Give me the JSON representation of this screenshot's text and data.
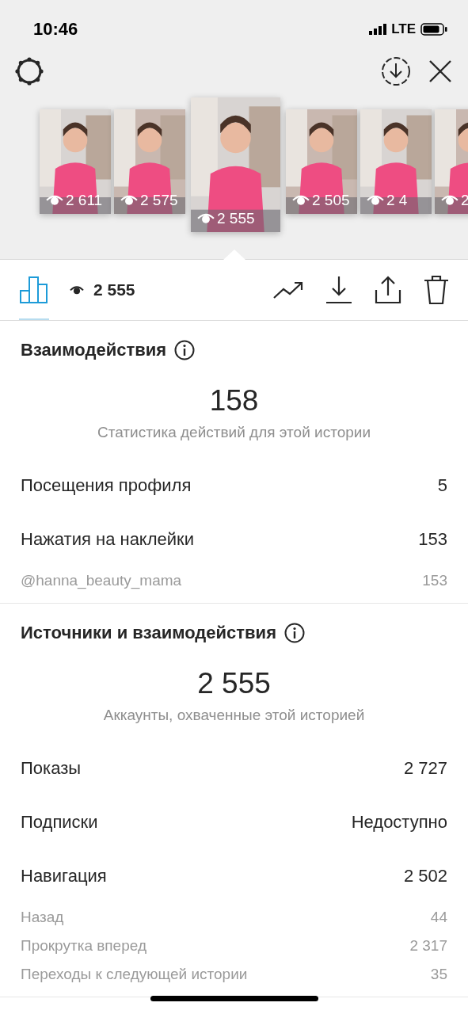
{
  "status_bar": {
    "time": "10:46",
    "network": "LTE"
  },
  "thumbnails": [
    {
      "views": "2 611",
      "selected": false
    },
    {
      "views": "2 575",
      "selected": false
    },
    {
      "views": "2 555",
      "selected": true
    },
    {
      "views": "2 505",
      "selected": false
    },
    {
      "views": "2 4",
      "selected": false
    },
    {
      "views": "2",
      "selected": false
    }
  ],
  "toolbar": {
    "tabs": [
      {
        "kind": "stats",
        "selected": true
      }
    ],
    "views": "2 555"
  },
  "sections": [
    {
      "title": "Взаимодействия",
      "total": "158",
      "caption": "Статистика действий для этой истории",
      "rows": [
        {
          "kind": "main",
          "label": "Посещения профиля",
          "value": "5"
        },
        {
          "kind": "main",
          "label": "Нажатия на наклейки",
          "value": "153"
        },
        {
          "kind": "sub",
          "label": "@hanna_beauty_mama",
          "value": "153"
        }
      ]
    },
    {
      "title": "Источники и взаимодействия",
      "total": "2 555",
      "caption": "Аккаунты, охваченные этой историей",
      "rows": [
        {
          "kind": "main",
          "label": "Показы",
          "value": "2 727"
        },
        {
          "kind": "main",
          "label": "Подписки",
          "value": "Недоступно"
        },
        {
          "kind": "main",
          "label": "Навигация",
          "value": "2 502"
        },
        {
          "kind": "sub",
          "label": "Назад",
          "value": "44"
        },
        {
          "kind": "sub",
          "label": "Прокрутка вперед",
          "value": "2 317"
        },
        {
          "kind": "sub",
          "label": "Переходы к следующей истории",
          "value": "35"
        }
      ]
    }
  ]
}
